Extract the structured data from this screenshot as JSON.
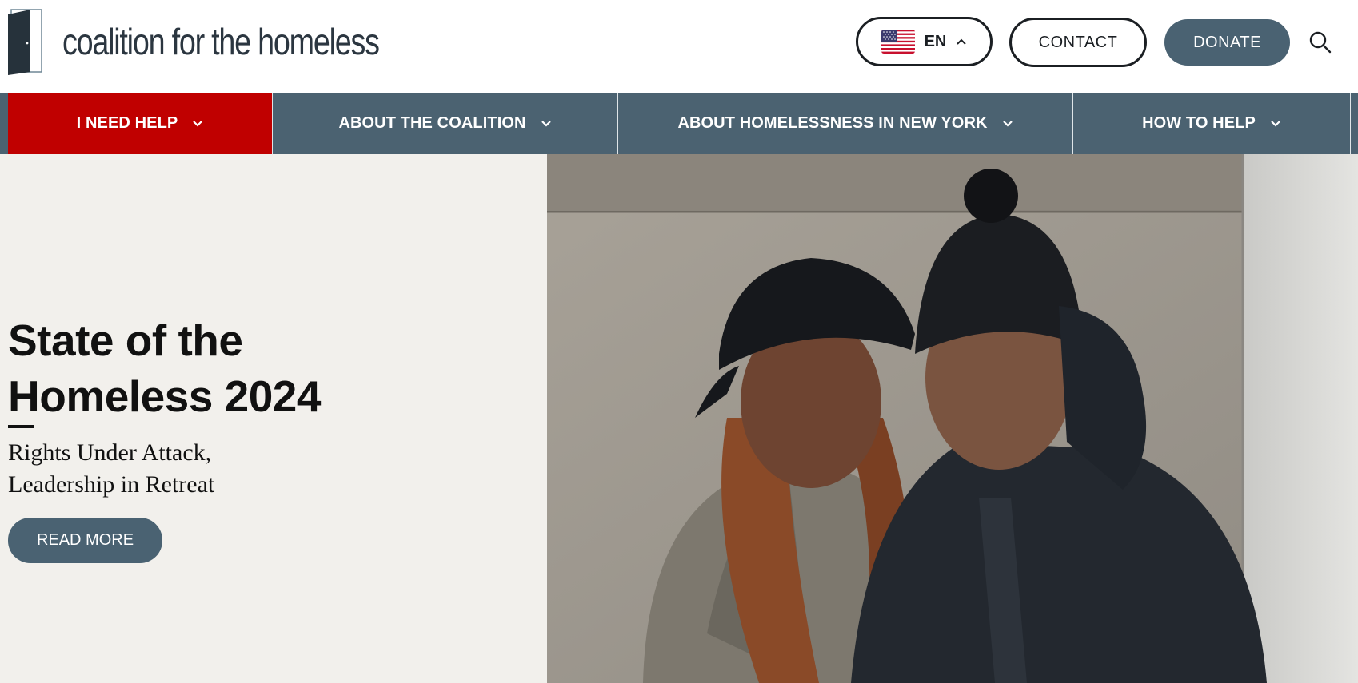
{
  "header": {
    "logo_text": "coalition for the homeless",
    "language": {
      "label": "EN",
      "flag": "us-flag-icon"
    },
    "contact_label": "CONTACT",
    "donate_label": "DONATE",
    "search_icon": "search-icon"
  },
  "nav": {
    "items": [
      {
        "label": "I NEED HELP",
        "active": true
      },
      {
        "label": "ABOUT THE COALITION",
        "active": false
      },
      {
        "label": "ABOUT HOMELESSNESS IN NEW YORK",
        "active": false
      },
      {
        "label": "HOW TO HELP",
        "active": false
      }
    ]
  },
  "hero": {
    "title_line1": "State of the",
    "title_line2": "Homeless 2024",
    "subtitle_line1": "Rights Under Attack,",
    "subtitle_line2": "Leadership in Retreat",
    "cta_label": "READ MORE"
  },
  "colors": {
    "nav_bg": "#4b6271",
    "active_red": "#c00000",
    "button_slate": "#4a6272",
    "hero_bg": "#f2f0ec",
    "text_dark": "#1b1f23"
  }
}
